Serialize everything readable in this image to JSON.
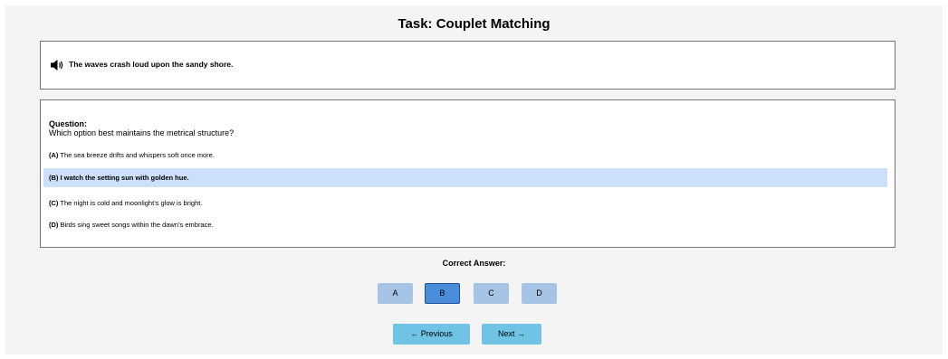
{
  "title": "Task: Couplet Matching",
  "prompt": {
    "icon": "speaker-icon",
    "text": "The waves crash loud upon the sandy shore."
  },
  "question": {
    "label": "Question:",
    "text": "Which option best maintains the metrical structure?",
    "options": [
      {
        "letter": "(A)",
        "text": "The sea breeze drifts and whispers soft once more.",
        "selected": false
      },
      {
        "letter": "(B)",
        "text": "I watch the setting sun with golden hue.",
        "selected": true
      },
      {
        "letter": "(C)",
        "text": "The night is cold and moonlight’s glow is bright.",
        "selected": false
      },
      {
        "letter": "(D)",
        "text": "Birds sing sweet songs within the dawn’s embrace.",
        "selected": false
      }
    ]
  },
  "answer": {
    "label": "Correct Answer:",
    "choices": [
      "A",
      "B",
      "C",
      "D"
    ],
    "selected": "B"
  },
  "nav": {
    "previous": "← Previous",
    "next": "Next →"
  },
  "colors": {
    "selected_option_bg": "#cce0fb",
    "answer_button": "#a5c3e5",
    "answer_button_active": "#4a8ddb",
    "nav_button": "#6fc3e5"
  }
}
